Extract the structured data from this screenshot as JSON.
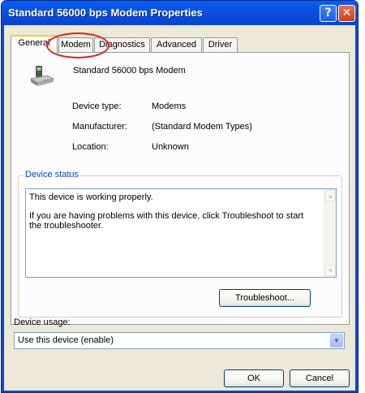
{
  "window": {
    "title": "Standard 56000 bps Modem Properties",
    "help_glyph": "?",
    "close_glyph": "✕"
  },
  "tabs": [
    {
      "label": "General",
      "active": true
    },
    {
      "label": "Modem",
      "active": false
    },
    {
      "label": "Diagnostics",
      "active": false
    },
    {
      "label": "Advanced",
      "active": false
    },
    {
      "label": "Driver",
      "active": false
    }
  ],
  "device": {
    "icon": "modem-device-icon",
    "name": "Standard 56000 bps Modem",
    "properties": [
      {
        "label": "Device type:",
        "value": "Modems"
      },
      {
        "label": "Manufacturer:",
        "value": "(Standard Modem Types)"
      },
      {
        "label": "Location:",
        "value": "Unknown"
      }
    ]
  },
  "status": {
    "group_title": "Device status",
    "line1": "This device is working properly.",
    "line2": "If you are having problems with this device, click Troubleshoot to start the troubleshooter.",
    "troubleshoot_label": "Troubleshoot..."
  },
  "usage": {
    "label": "Device usage:",
    "selected": "Use this device (enable)"
  },
  "buttons": {
    "ok": "OK",
    "cancel": "Cancel"
  },
  "annotation": {
    "highlight_color": "#e0201f",
    "highlight_target": "tab-modem"
  },
  "colors": {
    "titlebar": "#0a5ff5",
    "group_title": "#0046d5",
    "dialog_bg": "#ece9d8"
  }
}
